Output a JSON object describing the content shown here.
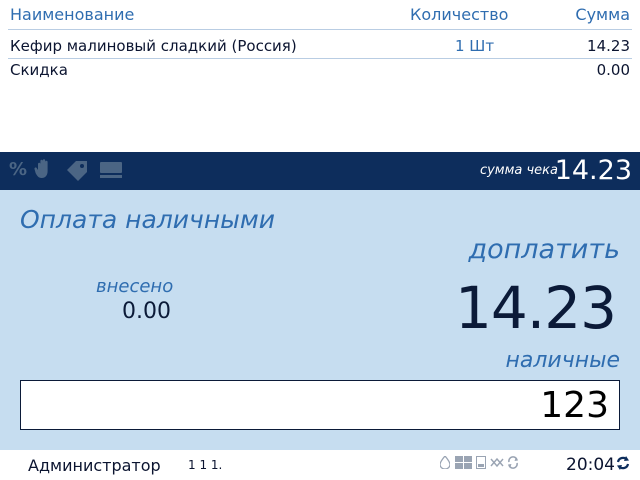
{
  "table": {
    "headers": {
      "name": "Наименование",
      "quantity": "Количество",
      "sum": "Сумма"
    },
    "rows": [
      {
        "name": "Кефир малиновый сладкий (Россия)",
        "quantity": "1 Шт",
        "sum": "14.23"
      },
      {
        "name": "Скидка",
        "quantity": "",
        "sum": "0.00"
      }
    ]
  },
  "bar": {
    "icons": [
      "percent-icon",
      "hand-icon",
      "tag-icon",
      "keyboard-icon"
    ],
    "receipt_total_label": "сумма чека",
    "receipt_total_value": "14.23"
  },
  "payment": {
    "title": "Оплата наличными",
    "due_label": "доплатить",
    "due_value": "14.23",
    "paid_label": "внесено",
    "paid_value": "0.00",
    "cash_label": "наличные",
    "cash_input_value": "123"
  },
  "status": {
    "user": "Администратор",
    "version": "1 1 1.",
    "icons": [
      "drop-icon",
      "cards-icon",
      "device-icon",
      "network-icon",
      "sync-icon",
      "refresh-icon"
    ],
    "time": "20:04"
  },
  "colors": {
    "accent_text": "#2f6db0",
    "dark_bar": "#0d2d5c",
    "panel_background": "#c6ddf0"
  }
}
